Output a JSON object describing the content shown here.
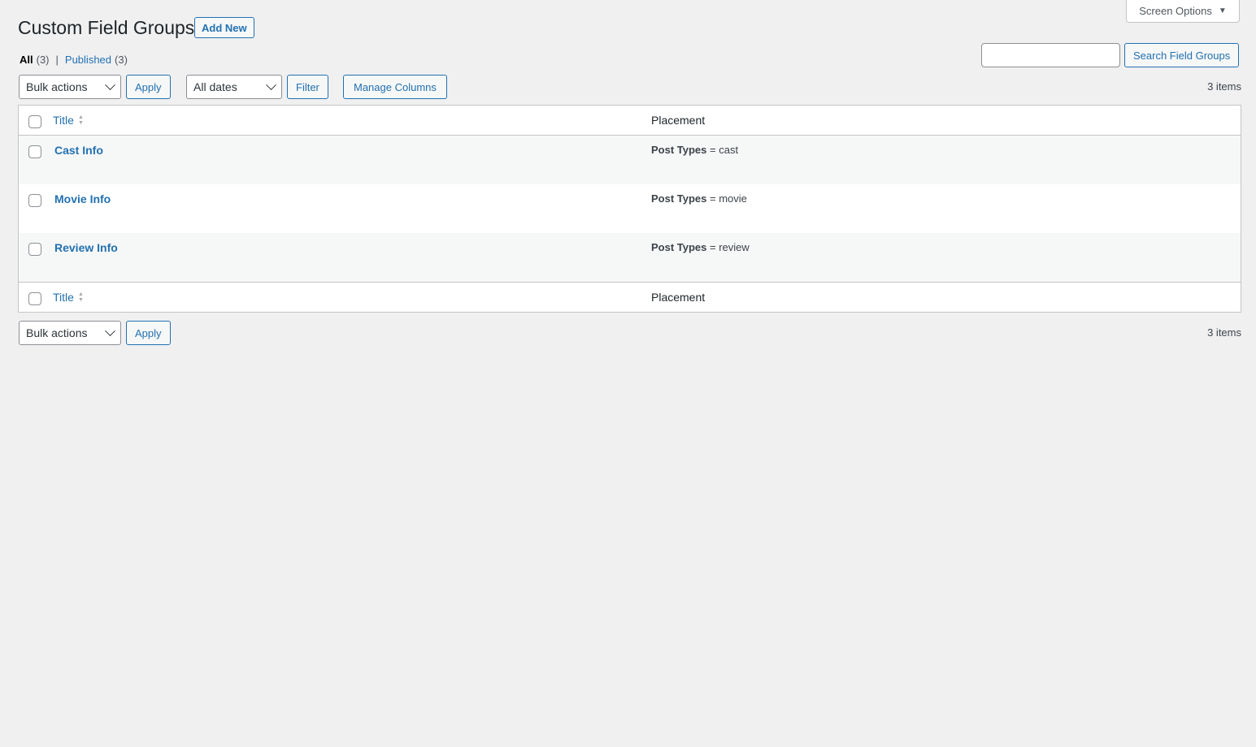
{
  "screen_options": {
    "label": "Screen Options"
  },
  "header": {
    "title": "Custom Field Groups",
    "add_new": "Add New"
  },
  "views": {
    "all_label": "All",
    "all_count": "(3)",
    "published_label": "Published",
    "published_count": "(3)",
    "separator": "|"
  },
  "search": {
    "value": "",
    "button": "Search Field Groups"
  },
  "tablenav_top": {
    "bulk_actions": "Bulk actions",
    "apply": "Apply",
    "dates": "All dates",
    "filter": "Filter",
    "manage_columns": "Manage Columns",
    "items": "3 items"
  },
  "table": {
    "columns": {
      "title": "Title",
      "placement": "Placement"
    },
    "rows": [
      {
        "title": "Cast Info",
        "placement_key": "Post Types",
        "placement_op": " = ",
        "placement_value": "cast"
      },
      {
        "title": "Movie Info",
        "placement_key": "Post Types",
        "placement_op": " = ",
        "placement_value": "movie"
      },
      {
        "title": "Review Info",
        "placement_key": "Post Types",
        "placement_op": " = ",
        "placement_value": "review"
      }
    ]
  },
  "tablenav_bottom": {
    "bulk_actions": "Bulk actions",
    "apply": "Apply",
    "items": "3 items"
  },
  "colors": {
    "background": "#f0f0f1",
    "link": "#2271b1",
    "text": "#1d2327",
    "border": "#c3c4c7"
  }
}
